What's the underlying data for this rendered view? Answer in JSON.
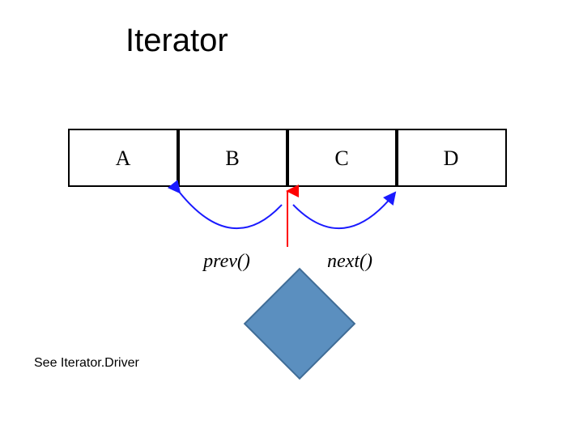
{
  "title": "Iterator",
  "footerNote": "See Iterator.Driver",
  "cells": [
    "A",
    "B",
    "C",
    "D"
  ],
  "methods": {
    "prev": "prev()",
    "next": "next()"
  },
  "colors": {
    "boxStroke": "#000000",
    "arrowBlue": "#1a1aff",
    "cursorRed": "#ff0000",
    "diamondFill": "#5b8fbf",
    "diamondStroke": "#3f6c96"
  },
  "chart_data": {
    "type": "table",
    "description": "Linear sequence of 4 cells with an iterator cursor positioned between cell B and cell C. prev() moves cursor left (between A and B); next() moves cursor right (between C and D). A rotated square (diamond) decorative shape sits under the cursor region.",
    "cells": [
      {
        "index": 0,
        "label": "A"
      },
      {
        "index": 1,
        "label": "B"
      },
      {
        "index": 2,
        "label": "C"
      },
      {
        "index": 3,
        "label": "D"
      }
    ],
    "cursor_position": {
      "between": [
        "B",
        "C"
      ],
      "between_indices": [
        1,
        2
      ]
    },
    "prev_target": {
      "between": [
        "A",
        "B"
      ],
      "between_indices": [
        0,
        1
      ]
    },
    "next_target": {
      "between": [
        "C",
        "D"
      ],
      "between_indices": [
        2,
        3
      ]
    }
  }
}
